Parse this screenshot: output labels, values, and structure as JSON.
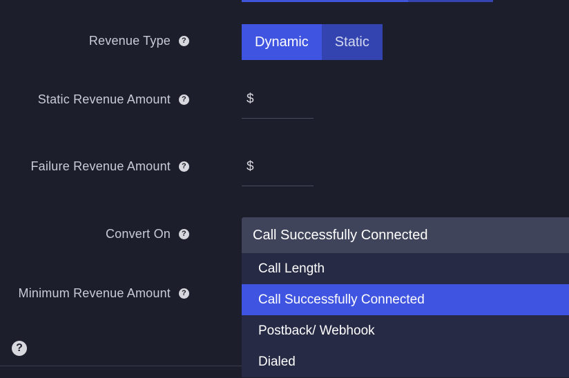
{
  "form": {
    "revenue_type": {
      "label": "Revenue Type",
      "options": [
        "Dynamic",
        "Static"
      ],
      "selected": "Dynamic"
    },
    "static_revenue": {
      "label": "Static Revenue Amount",
      "currency": "$",
      "value": ""
    },
    "failure_revenue": {
      "label": "Failure Revenue Amount",
      "currency": "$",
      "value": ""
    },
    "convert_on": {
      "label": "Convert On",
      "selected": "Call Successfully Connected",
      "options": [
        "Call Length",
        "Call Successfully Connected",
        "Postback/ Webhook",
        "Dialed"
      ]
    },
    "minimum_revenue": {
      "label": "Minimum Revenue Amount"
    }
  },
  "icons": {
    "help": "?"
  },
  "colors": {
    "background": "#1c1e2b",
    "accent": "#3f54e0",
    "dropdown_bg": "#262a45",
    "select_bg": "#40445a"
  }
}
